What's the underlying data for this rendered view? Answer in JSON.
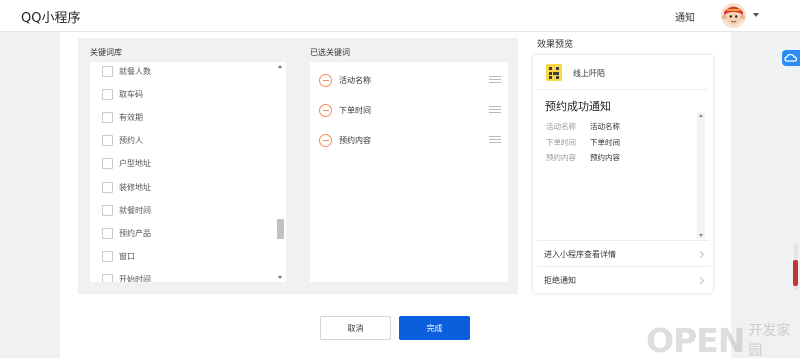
{
  "header": {
    "app_title": "QQ小程序",
    "notify_label": "通知"
  },
  "keyword_library": {
    "title": "关键词库",
    "items": [
      {
        "label": "就餐人数"
      },
      {
        "label": "取车码"
      },
      {
        "label": "有效期"
      },
      {
        "label": "预约人"
      },
      {
        "label": "户型地址"
      },
      {
        "label": "装修地址"
      },
      {
        "label": "就餐时间"
      },
      {
        "label": "预约产品"
      },
      {
        "label": "窗口"
      },
      {
        "label": "开始时间"
      }
    ]
  },
  "selected_keywords": {
    "title": "已选关键词",
    "items": [
      {
        "label": "活动名称"
      },
      {
        "label": "下单时间"
      },
      {
        "label": "预约内容"
      }
    ]
  },
  "preview": {
    "title": "效果预览",
    "app_name": "线上阡陌",
    "message_title": "预约成功通知",
    "fields": [
      {
        "key": "活动名称",
        "value": "活动名称"
      },
      {
        "key": "下单时间",
        "value": "下单时间"
      },
      {
        "key": "预约内容",
        "value": "预约内容"
      }
    ],
    "action_open": "进入小程序查看详情",
    "action_reject": "拒绝通知"
  },
  "footer": {
    "cancel_label": "取消",
    "done_label": "完成"
  },
  "watermark": {
    "text_latin": "OPEN",
    "text_cn": "开发家园"
  },
  "colors": {
    "primary": "#0b5fdc",
    "remove_icon": "#f1905a",
    "app_icon_bg": "#f7d64a"
  },
  "icons": {
    "remove": "minus-circle-icon",
    "drag": "drag-handle-icon",
    "chevron": "chevron-right-icon",
    "caret": "caret-down-icon",
    "cloud": "cloud-icon"
  }
}
